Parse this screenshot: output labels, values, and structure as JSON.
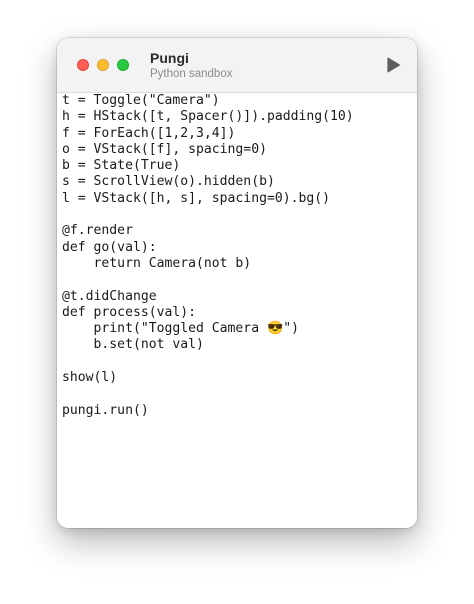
{
  "window": {
    "title": "Pungi",
    "subtitle": "Python sandbox"
  },
  "toolbar": {
    "run_icon": "play-icon"
  },
  "traffic_lights": {
    "close_color": "#ff5f57",
    "minimize_color": "#febc2e",
    "zoom_color": "#28c840"
  },
  "editor": {
    "lines": [
      "t = Toggle(\"Camera\")",
      "h = HStack([t, Spacer()]).padding(10)",
      "f = ForEach([1,2,3,4])",
      "o = VStack([f], spacing=0)",
      "b = State(True)",
      "s = ScrollView(o).hidden(b)",
      "l = VStack([h, s], spacing=0).bg()",
      "",
      "@f.render",
      "def go(val):",
      "    return Camera(not b)",
      "",
      "@t.didChange",
      "def process(val):",
      "    print(\"Toggled Camera 😎\")",
      "    b.set(not val)",
      "",
      "show(l)",
      "",
      "pungi.run()"
    ]
  }
}
